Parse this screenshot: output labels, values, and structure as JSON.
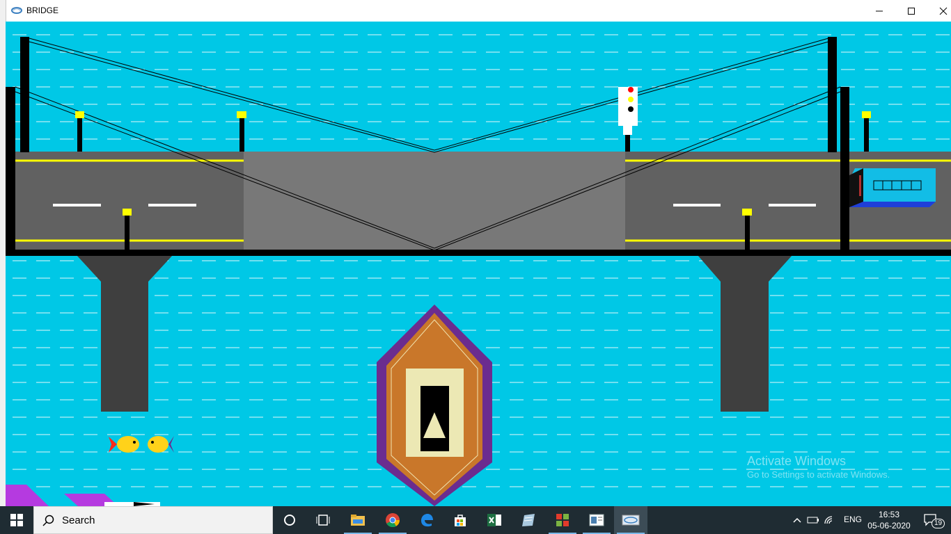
{
  "window": {
    "title": "BRIDGE",
    "controls": {
      "minimize_icon": "minimize-icon",
      "maximize_icon": "maximize-icon",
      "close_icon": "close-icon"
    }
  },
  "scene": {
    "colors": {
      "water": "#00c8e6",
      "wave": "#e6f7fb",
      "road": "#616161",
      "bridge_span": "#787878",
      "pillar": "#3f3f3f",
      "lamp": "#ffff00",
      "boat_outer": "#6b2c8f",
      "boat_body": "#c9772a",
      "boat_deck": "#ece8b4",
      "bus": "#12bde6",
      "fish": "#ffd21a"
    },
    "traffic_light": {
      "lights": [
        "red",
        "yellow",
        "off"
      ]
    }
  },
  "watermark": {
    "line1": "Activate Windows",
    "line2": "Go to Settings to activate Windows."
  },
  "taskbar": {
    "search_placeholder": "Search",
    "language": "ENG",
    "time": "16:53",
    "date": "05-06-2020",
    "notification_count": "19",
    "apps": [
      "cortana-icon",
      "task-view-icon",
      "file-explorer-icon",
      "chrome-icon",
      "edge-icon",
      "store-icon",
      "excel-icon",
      "notepad-icon",
      "office-icon",
      "tool-icon",
      "graphics-app-icon"
    ]
  }
}
